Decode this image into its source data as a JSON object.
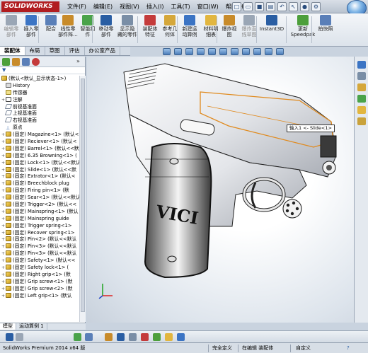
{
  "titlebar": {
    "logo": "SOLIDWORKS",
    "menus": [
      "文件(F)",
      "编辑(E)",
      "视图(V)",
      "插入(I)",
      "工具(T)",
      "窗口(W)",
      "帮助(H)"
    ]
  },
  "commands": [
    {
      "label": "编辑零\n部件",
      "icon": "edit-component-icon",
      "dim": true
    },
    {
      "label": "插入零\n部件",
      "icon": "insert-components-icon"
    },
    {
      "label": "配合",
      "icon": "mate-icon"
    },
    {
      "label": "线性零\n部件阵...",
      "icon": "linear-pattern-icon"
    },
    {
      "label": "智能扣\n件",
      "icon": "smart-fasteners-icon"
    },
    {
      "label": "移动零\n部件",
      "icon": "move-component-icon"
    },
    {
      "label": "显示隐\n藏的零件",
      "icon": "show-hidden-icon"
    },
    {
      "label": "装配体\n特征",
      "icon": "assembly-features-icon"
    },
    {
      "label": "参考几\n何体",
      "icon": "reference-geometry-icon"
    },
    {
      "label": "新建运\n动算例",
      "icon": "new-motion-study-icon"
    },
    {
      "label": "材料明\n细表",
      "icon": "bill-of-materials-icon"
    },
    {
      "label": "爆炸视\n图",
      "icon": "exploded-view-icon"
    },
    {
      "label": "爆炸直\n线草图",
      "icon": "explode-line-sketch-icon",
      "dim": true
    },
    {
      "label": "Instant3D",
      "icon": "instant3d-icon"
    },
    {
      "label": "更新\nSpeedpak",
      "icon": "update-speedpak-icon"
    },
    {
      "label": "拍快照",
      "icon": "snapshot-icon"
    }
  ],
  "tabs": [
    "装配体",
    "布局",
    "草图",
    "评估",
    "办公室产品"
  ],
  "tree": {
    "top": "(默认<默认_显示状态-1>)",
    "items": [
      {
        "label": "History",
        "icon": "hist",
        "ex": ""
      },
      {
        "label": "传感器",
        "icon": "sensor",
        "ex": ""
      },
      {
        "label": "注解",
        "icon": "note",
        "ex": "+"
      },
      {
        "label": "前视基准面",
        "icon": "plane",
        "ex": ""
      },
      {
        "label": "上视基准面",
        "icon": "plane",
        "ex": ""
      },
      {
        "label": "右视基准面",
        "icon": "plane",
        "ex": ""
      },
      {
        "label": "原点",
        "icon": "origin",
        "ex": ""
      },
      {
        "label": "(固定) Magazine<1> (默认<",
        "icon": "part",
        "ex": "+"
      },
      {
        "label": "(固定) Reciever<1> (默认<",
        "icon": "part",
        "ex": "+"
      },
      {
        "label": "(固定) Barrel<1> (默认<<默",
        "icon": "part",
        "ex": "+"
      },
      {
        "label": "(固定) 6.35 Browning<1> (",
        "icon": "part",
        "ex": "+"
      },
      {
        "label": "(固定) Lock<1> (默认<<默认",
        "icon": "part",
        "ex": "+"
      },
      {
        "label": "(固定) Slide<1> (默认<<默",
        "icon": "part",
        "ex": "+"
      },
      {
        "label": "(固定) Extrator<1> (默认<",
        "icon": "part",
        "ex": "+"
      },
      {
        "label": "(固定) Breechblock plug",
        "icon": "part",
        "ex": "+"
      },
      {
        "label": "(固定) Firing pin<1> (默",
        "icon": "part",
        "ex": "+"
      },
      {
        "label": "(固定) Sear<1> (默认<<默认",
        "icon": "part",
        "ex": "+"
      },
      {
        "label": "(固定) Trigger<2> (默认<<",
        "icon": "part",
        "ex": "+"
      },
      {
        "label": "(固定) Mainspring<1> (默认",
        "icon": "part",
        "ex": "+"
      },
      {
        "label": "(固定) Mainspring guide",
        "icon": "part",
        "ex": "+"
      },
      {
        "label": "(固定) Trigger spring<1>",
        "icon": "part",
        "ex": "+"
      },
      {
        "label": "(固定) Recover spring<1>",
        "icon": "part",
        "ex": "+"
      },
      {
        "label": "(固定) Pin<2> (默认<<默认",
        "icon": "part",
        "ex": "+"
      },
      {
        "label": "(固定) Pin<3> (默认<<默认",
        "icon": "part",
        "ex": "+"
      },
      {
        "label": "(固定) Pin<3> (默认<<默认",
        "icon": "part",
        "ex": "+"
      },
      {
        "label": "(固定) Safety<1> (默认<<",
        "icon": "part",
        "ex": "+"
      },
      {
        "label": "(固定) Safety lock<1> (",
        "icon": "part",
        "ex": "+"
      },
      {
        "label": "(固定) Right grip<1> (默",
        "icon": "part",
        "ex": "+"
      },
      {
        "label": "(固定) Grip screw<1> (默",
        "icon": "part",
        "ex": "+"
      },
      {
        "label": "(固定) Grip screw<2> (默",
        "icon": "part",
        "ex": "+"
      },
      {
        "label": "(固定) Left grip<1> (默认",
        "icon": "part",
        "ex": "+"
      }
    ]
  },
  "model_tabs": [
    "模型",
    "运动算例 1"
  ],
  "viewport": {
    "tooltip": "输入1 <- Slide<1>",
    "grip_text": "VICI"
  },
  "status": {
    "app": "SolidWorks Premium 2014 x64 版",
    "defined": "完全定义",
    "editing": "在编辑 装配体",
    "custom": "自定义"
  },
  "colors": {
    "highlight": "#e08a1e",
    "grip": "#1a1a1a",
    "accent": "#b11d20"
  }
}
